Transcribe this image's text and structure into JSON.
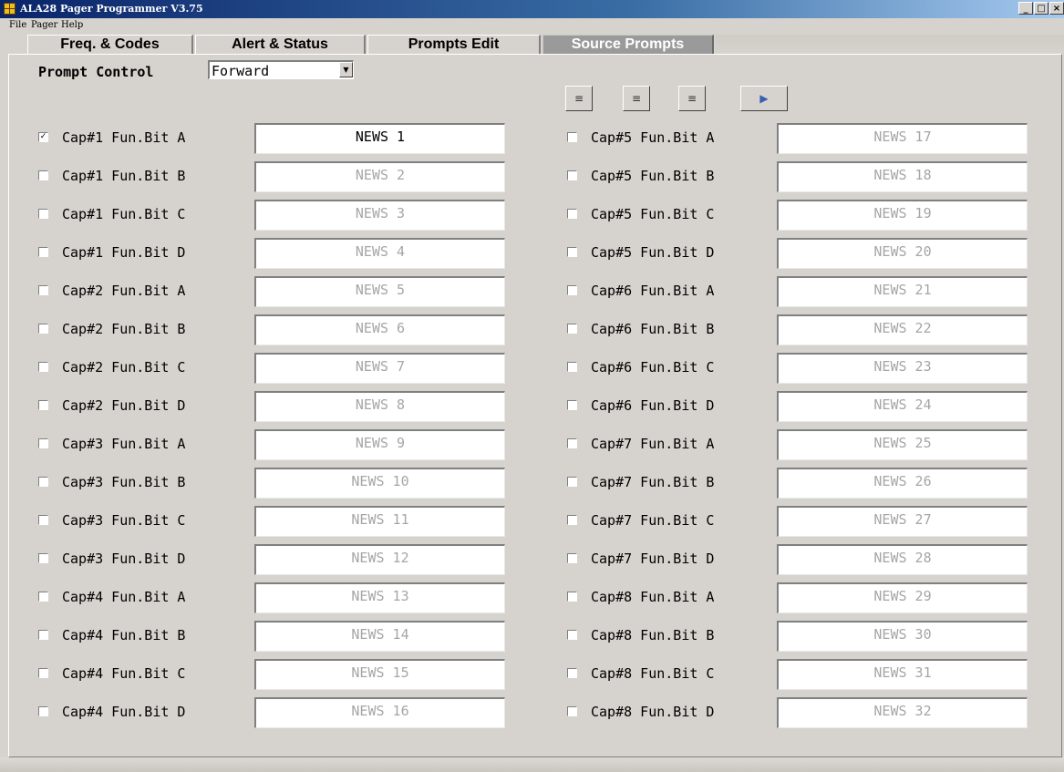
{
  "window": {
    "title": "ALA28 Pager Programmer V3.75"
  },
  "menu": [
    "File",
    "Pager",
    "Help"
  ],
  "tabs": [
    {
      "label": "Freq. & Codes"
    },
    {
      "label": "Alert & Status"
    },
    {
      "label": "Prompts Edit"
    },
    {
      "label": "Source Prompts",
      "active": true
    }
  ],
  "prompt_control": {
    "label": "Prompt Control",
    "value": "Forward"
  },
  "toolbar": [
    "align-right-icon",
    "align-center-icon",
    "align-left-icon",
    "apply-icon"
  ],
  "left_rows": [
    {
      "label": "Cap#1 Fun.Bit A",
      "value": "NEWS 1",
      "checked": true
    },
    {
      "label": "Cap#1 Fun.Bit B",
      "value": "NEWS 2",
      "checked": false
    },
    {
      "label": "Cap#1 Fun.Bit C",
      "value": "NEWS 3",
      "checked": false
    },
    {
      "label": "Cap#1 Fun.Bit D",
      "value": "NEWS 4",
      "checked": false
    },
    {
      "label": "Cap#2 Fun.Bit A",
      "value": "NEWS 5",
      "checked": false
    },
    {
      "label": "Cap#2 Fun.Bit B",
      "value": "NEWS 6",
      "checked": false
    },
    {
      "label": "Cap#2 Fun.Bit C",
      "value": "NEWS 7",
      "checked": false
    },
    {
      "label": "Cap#2 Fun.Bit D",
      "value": "NEWS 8",
      "checked": false
    },
    {
      "label": "Cap#3 Fun.Bit A",
      "value": "NEWS 9",
      "checked": false
    },
    {
      "label": "Cap#3 Fun.Bit B",
      "value": "NEWS 10",
      "checked": false
    },
    {
      "label": "Cap#3 Fun.Bit C",
      "value": "NEWS 11",
      "checked": false
    },
    {
      "label": "Cap#3 Fun.Bit D",
      "value": "NEWS 12",
      "checked": false
    },
    {
      "label": "Cap#4 Fun.Bit A",
      "value": "NEWS 13",
      "checked": false
    },
    {
      "label": "Cap#4 Fun.Bit B",
      "value": "NEWS 14",
      "checked": false
    },
    {
      "label": "Cap#4 Fun.Bit C",
      "value": "NEWS 15",
      "checked": false
    },
    {
      "label": "Cap#4 Fun.Bit D",
      "value": "NEWS 16",
      "checked": false
    }
  ],
  "right_rows": [
    {
      "label": "Cap#5 Fun.Bit A",
      "value": "NEWS 17",
      "checked": false
    },
    {
      "label": "Cap#5 Fun.Bit B",
      "value": "NEWS 18",
      "checked": false
    },
    {
      "label": "Cap#5 Fun.Bit C",
      "value": "NEWS 19",
      "checked": false
    },
    {
      "label": "Cap#5 Fun.Bit D",
      "value": "NEWS 20",
      "checked": false
    },
    {
      "label": "Cap#6 Fun.Bit A",
      "value": "NEWS 21",
      "checked": false
    },
    {
      "label": "Cap#6 Fun.Bit B",
      "value": "NEWS 22",
      "checked": false
    },
    {
      "label": "Cap#6 Fun.Bit C",
      "value": "NEWS 23",
      "checked": false
    },
    {
      "label": "Cap#6 Fun.Bit D",
      "value": "NEWS 24",
      "checked": false
    },
    {
      "label": "Cap#7 Fun.Bit A",
      "value": "NEWS 25",
      "checked": false
    },
    {
      "label": "Cap#7 Fun.Bit B",
      "value": "NEWS 26",
      "checked": false
    },
    {
      "label": "Cap#7 Fun.Bit C",
      "value": "NEWS 27",
      "checked": false
    },
    {
      "label": "Cap#7 Fun.Bit D",
      "value": "NEWS 28",
      "checked": false
    },
    {
      "label": "Cap#8 Fun.Bit A",
      "value": "NEWS 29",
      "checked": false
    },
    {
      "label": "Cap#8 Fun.Bit B",
      "value": "NEWS 30",
      "checked": false
    },
    {
      "label": "Cap#8 Fun.Bit C",
      "value": "NEWS 31",
      "checked": false
    },
    {
      "label": "Cap#8 Fun.Bit D",
      "value": "NEWS 32",
      "checked": false
    }
  ]
}
